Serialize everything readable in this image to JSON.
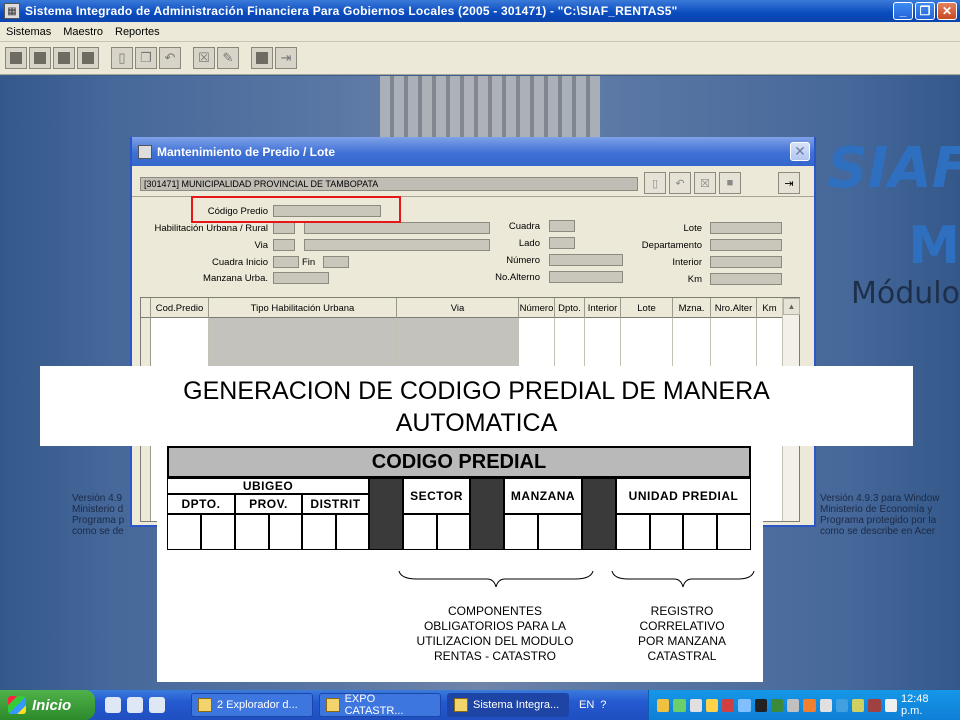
{
  "app": {
    "title": "Sistema Integrado de Administración Financiera Para Gobiernos Locales (2005 - 301471) - \"C:\\SIAF_RENTAS5\"",
    "menu": [
      "Sistemas",
      "Maestro",
      "Reportes"
    ]
  },
  "background": {
    "logo": "SIAF",
    "logo_sub": "M",
    "module_text": "Módulo",
    "version_left": [
      "Versión 4.9",
      "Ministerio d",
      "Programa p",
      "como se de"
    ],
    "version_right": [
      "Versión 4.9.3 para Window",
      "Ministerio de Economía y",
      "Programa protegido por la",
      "como se describe en Acer"
    ]
  },
  "dialog": {
    "title": "Mantenimiento de Predio / Lote",
    "entity": "[301471] MUNICIPALIDAD PROVINCIAL DE TAMBOPATA",
    "labels": {
      "codigo_predio": "Código Predio",
      "habilitacion": "Habilitación Urbana / Rural",
      "via": "Via",
      "cuadra_inicio": "Cuadra Inicio",
      "fin": "Fin",
      "manzana": "Manzana Urba.",
      "cuadra": "Cuadra",
      "lado": "Lado",
      "numero": "Número",
      "no_alterno": "No.Alterno",
      "lote": "Lote",
      "departamento": "Departamento",
      "interior": "Interior",
      "km": "Km"
    },
    "grid_columns": [
      "Cod.Predio",
      "Tipo Habilitación Urbana",
      "Via",
      "Número",
      "Dpto.",
      "Interior",
      "Lote",
      "Mzna.",
      "Nro.Alter",
      "Km"
    ]
  },
  "slide": {
    "banner_line1": "GENERACION DE CODIGO PREDIAL DE MANERA",
    "banner_line2": "AUTOMATICA",
    "table_title": "CODIGO PREDIAL",
    "ubigeo": "UBIGEO",
    "dpto": "DPTO.",
    "prov": "PROV.",
    "distrit": "DISTRIT",
    "sector": "SECTOR",
    "manzana": "MANZANA",
    "unidad_predial": "UNIDAD PREDIAL",
    "componentes": [
      "COMPONENTES",
      "OBLIGATORIOS PARA LA",
      "UTILIZACION DEL MODULO",
      "RENTAS - CATASTRO"
    ],
    "registro": [
      "REGISTRO",
      "CORRELATIVO",
      "POR  MANZANA",
      "CATASTRAL"
    ]
  },
  "taskbar": {
    "start": "Inicio",
    "tasks": [
      "2 Explorador d...",
      "EXPO CATASTR...",
      "Sistema Integra..."
    ],
    "lang": "EN",
    "clock": "12:48 p.m."
  },
  "colors": {
    "highlight": "#e41818",
    "titlebar": "#0a4bbf",
    "dialog_bg": "#ece9d8"
  }
}
